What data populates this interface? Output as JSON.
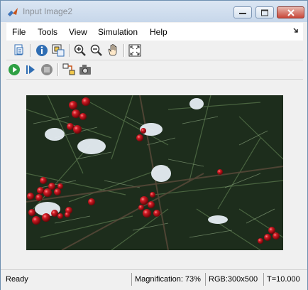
{
  "window": {
    "title": "Input Image2"
  },
  "menu": {
    "items": [
      "File",
      "Tools",
      "View",
      "Simulation",
      "Help"
    ]
  },
  "toolbar": {
    "row1_icons": [
      "print-icon",
      "info-icon",
      "pixel-region-icon",
      "zoom-in-icon",
      "zoom-out-icon",
      "pan-hand-icon",
      "fit-to-window-icon"
    ],
    "row2_icons": [
      "run-icon",
      "step-forward-icon",
      "stop-icon",
      "highlight-block-icon",
      "snapshot-icon"
    ]
  },
  "image": {
    "subject": "berries-on-evergreen"
  },
  "status": {
    "state": "Ready",
    "magnification": "Magnification: 73%",
    "format": "RGB:300x500",
    "time": "T=10.000"
  },
  "colors": {
    "run_green": "#2ea043",
    "stop_gray": "#8c8c8c",
    "berry_red": "#c8141e",
    "accent_blue": "#2f6db3"
  }
}
